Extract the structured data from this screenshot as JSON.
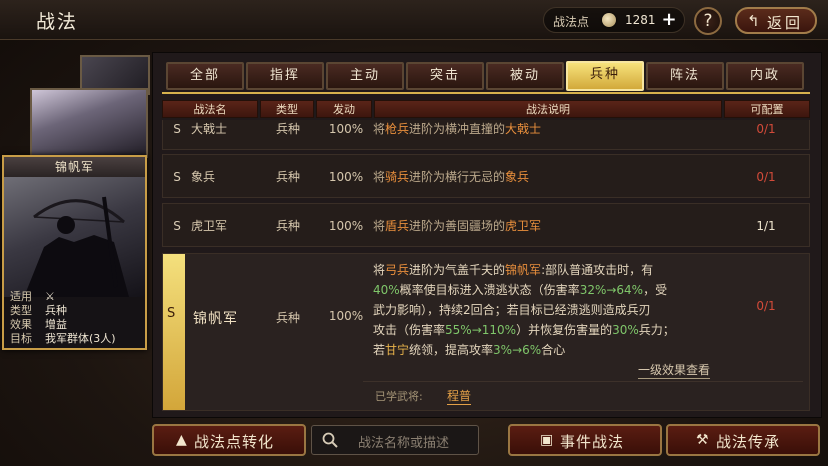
{
  "header": {
    "title": "战法",
    "points_label": "战法点",
    "points_value": "1281",
    "plus": "+",
    "help": "?",
    "back": "返回"
  },
  "hero_card": {
    "name": "锦帆军",
    "info": [
      {
        "k": "适用",
        "v": ""
      },
      {
        "k": "类型",
        "v": "兵种"
      },
      {
        "k": "效果",
        "v": "增益"
      },
      {
        "k": "目标",
        "v": "我军群体(3人)"
      }
    ]
  },
  "tabs": [
    "全部",
    "指挥",
    "主动",
    "突击",
    "被动",
    "兵种",
    "阵法",
    "内政"
  ],
  "active_tab": "兵种",
  "columns": [
    "战法名",
    "类型",
    "发动",
    "战法说明",
    "可配置"
  ],
  "rows": [
    {
      "grade": "S",
      "name": "大戟士",
      "type": "兵种",
      "rate": "100%",
      "desc": [
        "将",
        "枪兵",
        "进阶为横冲直撞的",
        "大戟士"
      ],
      "config": "0/1"
    },
    {
      "grade": "S",
      "name": "象兵",
      "type": "兵种",
      "rate": "100%",
      "desc": [
        "将",
        "骑兵",
        "进阶为横行无忌的",
        "象兵"
      ],
      "config": "0/1"
    },
    {
      "grade": "S",
      "name": "虎卫军",
      "type": "兵种",
      "rate": "100%",
      "desc": [
        "将",
        "盾兵",
        "进阶为善固疆场的",
        "虎卫军"
      ],
      "config": "1/1"
    }
  ],
  "expanded": {
    "grade": "S",
    "name": "锦帆军",
    "type": "兵种",
    "rate": "100%",
    "config": "0/1",
    "desc_parts": {
      "p1": "将",
      "p2": "弓兵",
      "p3": "进阶为气盖千夫的",
      "p4": "锦帆军",
      "p5": ":部队普通攻击时，有",
      "p6": "40%",
      "p7": "概率使目标进入溃逃状态（伤害率",
      "p8": "32%→64%",
      "p9": "，受",
      "p10": "武力影响），持续2回合；若目标已经溃逃则造成兵刃",
      "p11": "攻击（伤害率",
      "p12": "55%→110%",
      "p13": "）并恢复伤害量的",
      "p14": "30%",
      "p15": "兵力；",
      "p16": "若",
      "p17": "甘宁",
      "p18": "统领，提高攻率",
      "p19": "3%→6%",
      "p20": "合心"
    },
    "more": "一级效果查看",
    "learned_label": "已学武将:",
    "learned_general": "程普"
  },
  "bottom": {
    "convert": "战法点转化",
    "search_placeholder": "战法名称或描述",
    "event": "事件战法",
    "inherit": "战法传承"
  }
}
